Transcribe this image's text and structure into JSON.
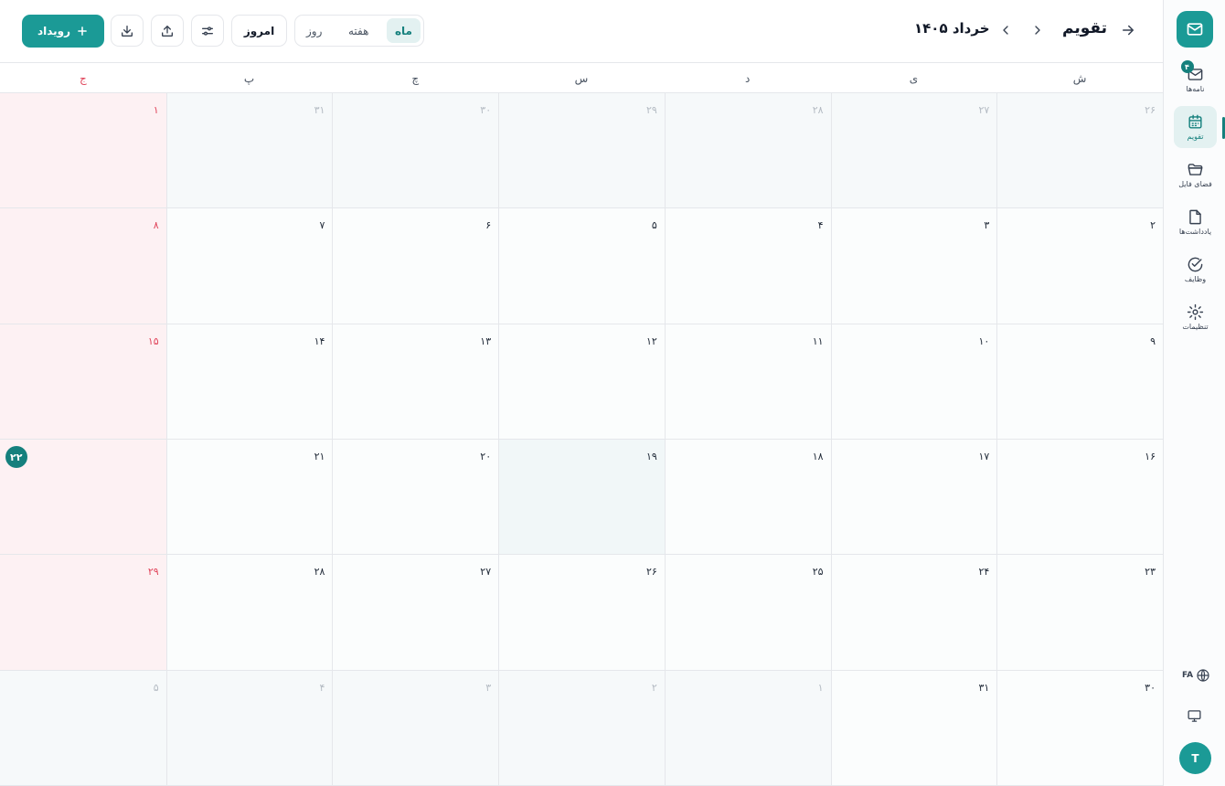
{
  "app": {
    "title": "تقویم",
    "month_label": "خرداد ۱۴۰۵"
  },
  "toolbar": {
    "views": [
      {
        "label": "ماه",
        "active": true
      },
      {
        "label": "هفته",
        "active": false
      },
      {
        "label": "روز",
        "active": false
      }
    ],
    "today_label": "امروز",
    "add_event_label": "رویداد"
  },
  "sidebar": {
    "items": [
      {
        "label": "نامه‌ها",
        "icon": "mail-icon",
        "badge": "۴"
      },
      {
        "label": "تقویم",
        "icon": "calendar-icon",
        "active": true
      },
      {
        "label": "فضای فایل",
        "icon": "folder-icon"
      },
      {
        "label": "یادداشت‌ها",
        "icon": "note-icon"
      },
      {
        "label": "وظایف",
        "icon": "check-circle-icon"
      },
      {
        "label": "تنظیمات",
        "icon": "gear-icon"
      }
    ],
    "language": "FA",
    "avatar_initial": "T"
  },
  "calendar": {
    "weekdays": [
      "ش",
      "ی",
      "د",
      "س",
      "چ",
      "پ",
      "ج"
    ],
    "weeks": [
      [
        {
          "d": "۲۶",
          "outside": true
        },
        {
          "d": "۲۷",
          "outside": true
        },
        {
          "d": "۲۸",
          "outside": true
        },
        {
          "d": "۲۹",
          "outside": true
        },
        {
          "d": "۳۰",
          "outside": true
        },
        {
          "d": "۳۱",
          "outside": true
        },
        {
          "d": "۱",
          "holiday": true
        }
      ],
      [
        {
          "d": "۲"
        },
        {
          "d": "۳"
        },
        {
          "d": "۴"
        },
        {
          "d": "۵"
        },
        {
          "d": "۶"
        },
        {
          "d": "۷"
        },
        {
          "d": "۸",
          "holiday": true
        }
      ],
      [
        {
          "d": "۹"
        },
        {
          "d": "۱۰"
        },
        {
          "d": "۱۱"
        },
        {
          "d": "۱۲"
        },
        {
          "d": "۱۳"
        },
        {
          "d": "۱۴"
        },
        {
          "d": "۱۵",
          "holiday": true
        }
      ],
      [
        {
          "d": "۱۶"
        },
        {
          "d": "۱۷"
        },
        {
          "d": "۱۸"
        },
        {
          "d": "۱۹",
          "highlight": true
        },
        {
          "d": "۲۰"
        },
        {
          "d": "۲۱"
        },
        {
          "d": "۲۲",
          "holiday": true,
          "today": true
        }
      ],
      [
        {
          "d": "۲۳"
        },
        {
          "d": "۲۴"
        },
        {
          "d": "۲۵"
        },
        {
          "d": "۲۶"
        },
        {
          "d": "۲۷"
        },
        {
          "d": "۲۸"
        },
        {
          "d": "۲۹",
          "holiday": true
        }
      ],
      [
        {
          "d": "۳۰"
        },
        {
          "d": "۳۱"
        },
        {
          "d": "۱",
          "outside": true
        },
        {
          "d": "۲",
          "outside": true
        },
        {
          "d": "۳",
          "outside": true
        },
        {
          "d": "۴",
          "outside": true
        },
        {
          "d": "۵",
          "outside": true
        }
      ]
    ]
  },
  "colors": {
    "accent": "#1b9a96",
    "holiday": "#e0445a"
  }
}
